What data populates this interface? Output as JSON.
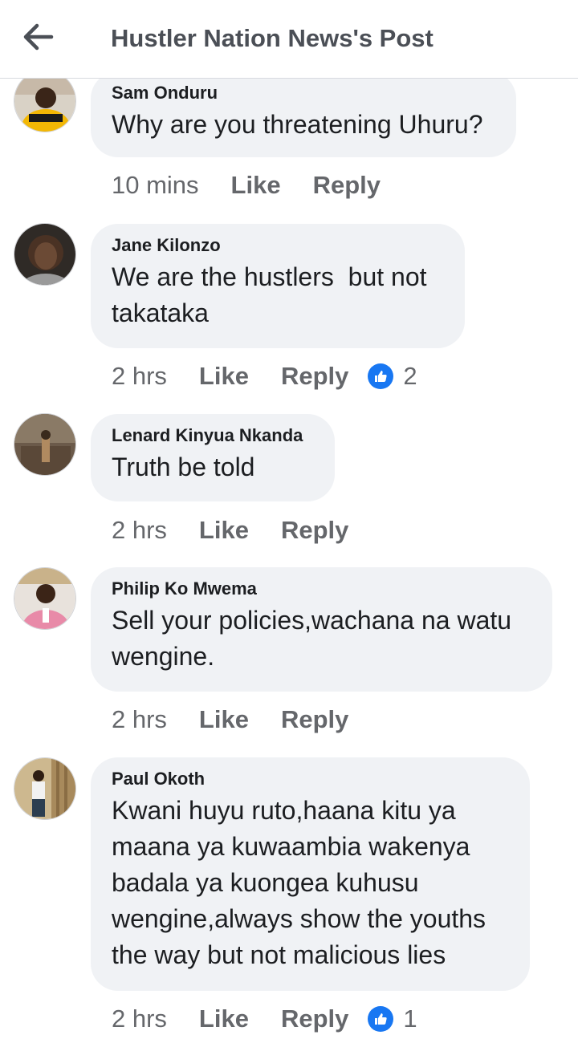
{
  "header": {
    "title": "Hustler Nation News's Post",
    "back_icon": "arrow-left-icon"
  },
  "comments": [
    {
      "author": "Sam Onduru",
      "lines": [
        "Why are you threatening Uhuru?"
      ],
      "time": "10 mins",
      "like_label": "Like",
      "reply_label": "Reply",
      "reactions": null
    },
    {
      "author": "Jane Kilonzo",
      "lines": [
        "We are the hustlers  but not",
        "takataka"
      ],
      "time": "2 hrs",
      "like_label": "Like",
      "reply_label": "Reply",
      "reactions": "2"
    },
    {
      "author": "Lenard Kinyua Nkanda",
      "lines": [
        "Truth be told"
      ],
      "time": "2 hrs",
      "like_label": "Like",
      "reply_label": "Reply",
      "reactions": null
    },
    {
      "author": "Philip Ko Mwema",
      "lines": [
        "Sell your policies,wachana na watu",
        "wengine."
      ],
      "time": "2 hrs",
      "like_label": "Like",
      "reply_label": "Reply",
      "reactions": null
    },
    {
      "author": "Paul Okoth",
      "lines": [
        "Kwani huyu ruto,haana kitu ya",
        "maana ya kuwaambia wakenya",
        "badala ya kuongea kuhusu",
        "wengine,always show the youths",
        "the way but not malicious lies"
      ],
      "time": "2 hrs",
      "like_label": "Like",
      "reply_label": "Reply",
      "reactions": "1"
    }
  ],
  "colors": {
    "bubble": "#f0f2f5",
    "like_blue": "#1877f2",
    "meta_gray": "#65676b",
    "text": "#1c1e21"
  }
}
